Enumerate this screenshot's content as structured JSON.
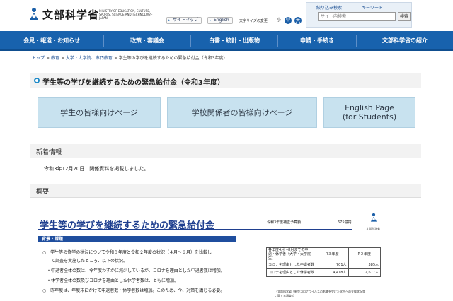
{
  "header": {
    "logo_text": "文部科学省",
    "logo_subtitle": "MINISTRY OF EDUCATION, CULTURE, SPORTS, SCIENCE AND TECHNOLOGY-JAPAN",
    "sitemap_label": "サイトマップ",
    "english_label": "English",
    "font_size_label": "文字サイズの変更",
    "font_small": "小",
    "font_medium": "中",
    "font_large": "大",
    "bookmark_search": "絞り込み検索",
    "keyword": "キーワード",
    "search_placeholder": "サイト内検索",
    "search_button": "検索"
  },
  "nav": {
    "items": [
      "会見・報道・お知らせ",
      "政策・審議会",
      "白書・統計・出版物",
      "申請・手続き",
      "文部科学省の紹介"
    ]
  },
  "breadcrumb": {
    "items": [
      "トップ",
      "教育",
      "大学・大学院、専門教育"
    ],
    "current": "学生等の学びを継続するための緊急給付金（令和3年度）",
    "separator": ">"
  },
  "page_title": "学生等の学びを継続するための緊急給付金（令和3年度）",
  "buttons": {
    "students": "学生の皆様向けページ",
    "schools": "学校関係者の皆様向けページ",
    "english_line1": "English Page",
    "english_line2": "(for Students)"
  },
  "news": {
    "heading": "新着情報",
    "entry": "令和3年12月20日　関係資料を掲載しました。"
  },
  "overview": {
    "heading": "概要"
  },
  "figure": {
    "title": "学生等の学びを継続するための緊急給付金",
    "budget_label": "令和3年度補正予算額",
    "budget_amount": "675億円",
    "org": "文部科学省",
    "tag": "背景・課題",
    "line1": "○　学生等の修学の状況について令和３年度と令和２年度の状況（４月～８月）を比較し",
    "line2": "　　て調査を実施したところ、以下の状況。",
    "line3": "　・中退者全体の数は、今年度わずかに減少しているが、コロナを理由とした中退者数は増加。",
    "line4": "　・休学者全体の数及びコロナを理由とした休学者数は、ともに増加。",
    "line5": "○　昨年度は、年度末にかけて中退者数・休学者数は増加。このため、今、対策を講じる必要。",
    "table": {
      "header_label": "各年度4月〜8月までの中退・休学者（大学・大学院生）",
      "col_r3": "R３年度",
      "col_r2": "R２年度",
      "rows": [
        {
          "label": "コロナを理由とした中退者数",
          "r3": "701人",
          "r2": "385人"
        },
        {
          "label": "コロナを理由とした休学者数",
          "r3": "4,418人",
          "r2": "2,677人"
        }
      ],
      "note": "（文部科学省「新型コロナウイルスの影響を受けた学生への支援状況等に関する調査」）"
    }
  },
  "colors": {
    "nav_bg": "#1862ad",
    "button_bg": "#c8e2ef",
    "figure_accent": "#1f3f8f"
  }
}
